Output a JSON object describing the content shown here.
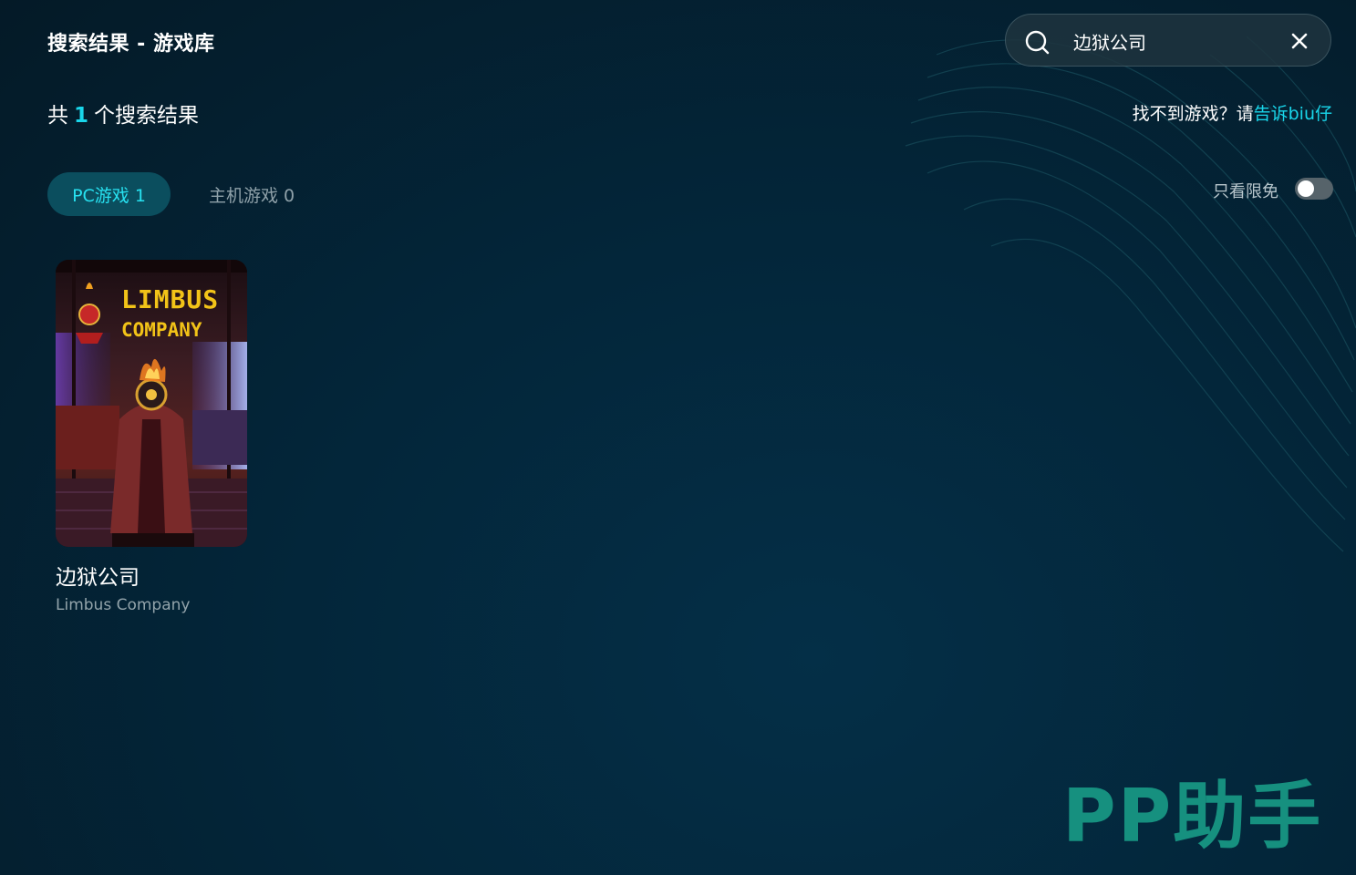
{
  "header": {
    "title": "搜索结果 - 游戏库"
  },
  "search": {
    "value": "边狱公司"
  },
  "summary": {
    "prefix": "共",
    "count": "1",
    "suffix": "个搜索结果"
  },
  "help": {
    "text": "找不到游戏？请",
    "link": "告诉biu仔"
  },
  "tabs": [
    {
      "label": "PC游戏 1",
      "active": true
    },
    {
      "label": "主机游戏 0",
      "active": false
    }
  ],
  "filter": {
    "label": "只看限免",
    "enabled": false
  },
  "games": [
    {
      "title": "边狱公司",
      "subtitle": "Limbus Company",
      "cover_text": [
        "LIMBUS",
        "COMPANY"
      ]
    }
  ],
  "brand": {
    "logo": "PP助手"
  },
  "colors": {
    "accent": "#19d6ea",
    "background": "#03263a",
    "brand": "#16907f",
    "cover_title": "#f2c318"
  },
  "icons": {
    "search": "search-icon",
    "clear": "close-icon"
  }
}
